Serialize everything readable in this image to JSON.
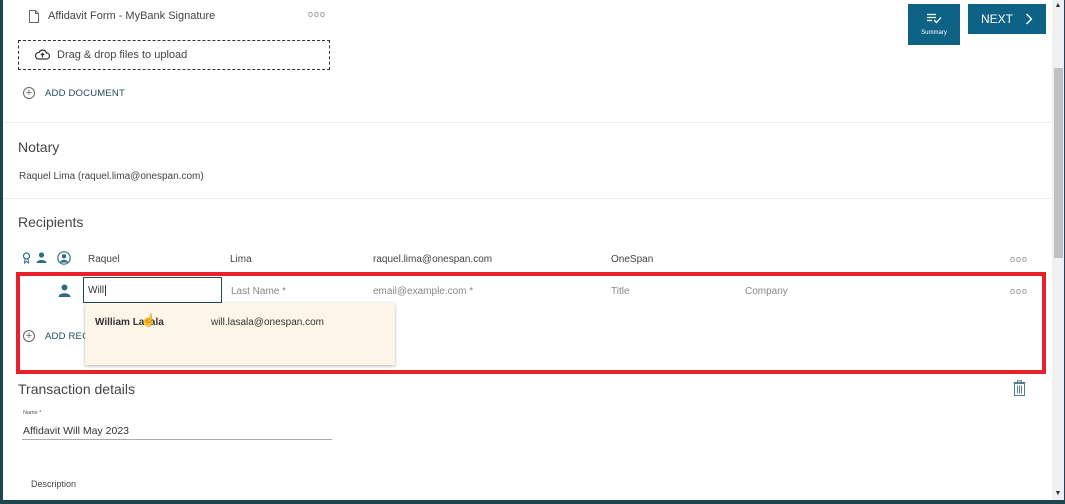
{
  "documents": {
    "items": [
      {
        "name": "Affidavit Form - MyBank Signature",
        "menu": "ooo"
      }
    ],
    "dropzone_label": "Drag & drop files to upload",
    "add_document_label": "ADD DOCUMENT"
  },
  "header": {
    "summary_label": "Summary",
    "next_label": "NEXT",
    "next_chevron": "›"
  },
  "notary": {
    "title": "Notary",
    "value": "Raquel Lima (raquel.lima@onespan.com)"
  },
  "recipients": {
    "title": "Recipients",
    "rows": [
      {
        "first_name": "Raquel",
        "last_name": "Lima",
        "email": "raquel.lima@onespan.com",
        "company": "OneSpan",
        "menu": "ooo"
      }
    ],
    "new_row": {
      "first_name_value": "Will",
      "last_name_placeholder": "Last Name *",
      "email_placeholder": "email@example.com *",
      "title_placeholder": "Title",
      "company_placeholder": "Company",
      "menu": "ooo"
    },
    "autocomplete": [
      {
        "name": "William Lasala",
        "email": "will.lasala@onespan.com"
      }
    ],
    "add_recipient_label": "ADD REC"
  },
  "transaction": {
    "title": "Transaction details",
    "name_label": "Name *",
    "name_value": "Affidavit Will May 2023",
    "description_label": "Description"
  },
  "colors": {
    "accent": "#0e6286",
    "highlight": "#e8202a",
    "suggestion_bg": "#fdf6e8"
  }
}
